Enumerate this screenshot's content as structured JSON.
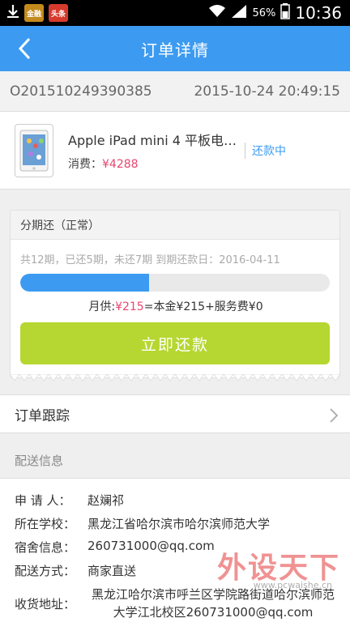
{
  "statusbar": {
    "app_left_label": "金融",
    "app_right_label": "头条",
    "battery": "56%",
    "time": "10:36"
  },
  "navbar": {
    "title": "订单详情"
  },
  "order": {
    "id": "O201510249390385",
    "datetime": "2015-10-24 20:49:15"
  },
  "product": {
    "name": "Apple iPad mini 4 平板电…",
    "price_label": "消费：",
    "price_value": "¥4288",
    "status": "还款中"
  },
  "installment": {
    "title": "分期还（正常）",
    "summary": "共12期，已还5期，未还7期   到期还款日：2016-04-11",
    "progress_paid": 5,
    "progress_total": 12,
    "monthly_label": "月供:",
    "monthly_value": "¥215",
    "monthly_breakdown": "=本金¥215+服务费¥0",
    "repay_button": "立即还款"
  },
  "tracking": {
    "label": "订单跟踪"
  },
  "delivery": {
    "section_title": "配送信息",
    "rows": [
      {
        "label": "申 请 人：",
        "value": "赵斓祁"
      },
      {
        "label": "所在学校：",
        "value": "黑龙江省哈尔滨市哈尔滨师范大学"
      },
      {
        "label": "宿舍信息：",
        "value": "260731000@qq.com"
      },
      {
        "label": "配送方式：",
        "value": "商家直送"
      },
      {
        "label": "收货地址：",
        "value": "黑龙江哈尔滨市呼兰区学院路街道哈尔滨师范大学江北校区260731000@qq.com"
      }
    ]
  },
  "watermark": {
    "main": "外设天下",
    "sub": "www.pcwaishe.cn"
  },
  "colors": {
    "accent": "#3c9bf1",
    "price": "#e8466f",
    "button": "#b6d731"
  }
}
